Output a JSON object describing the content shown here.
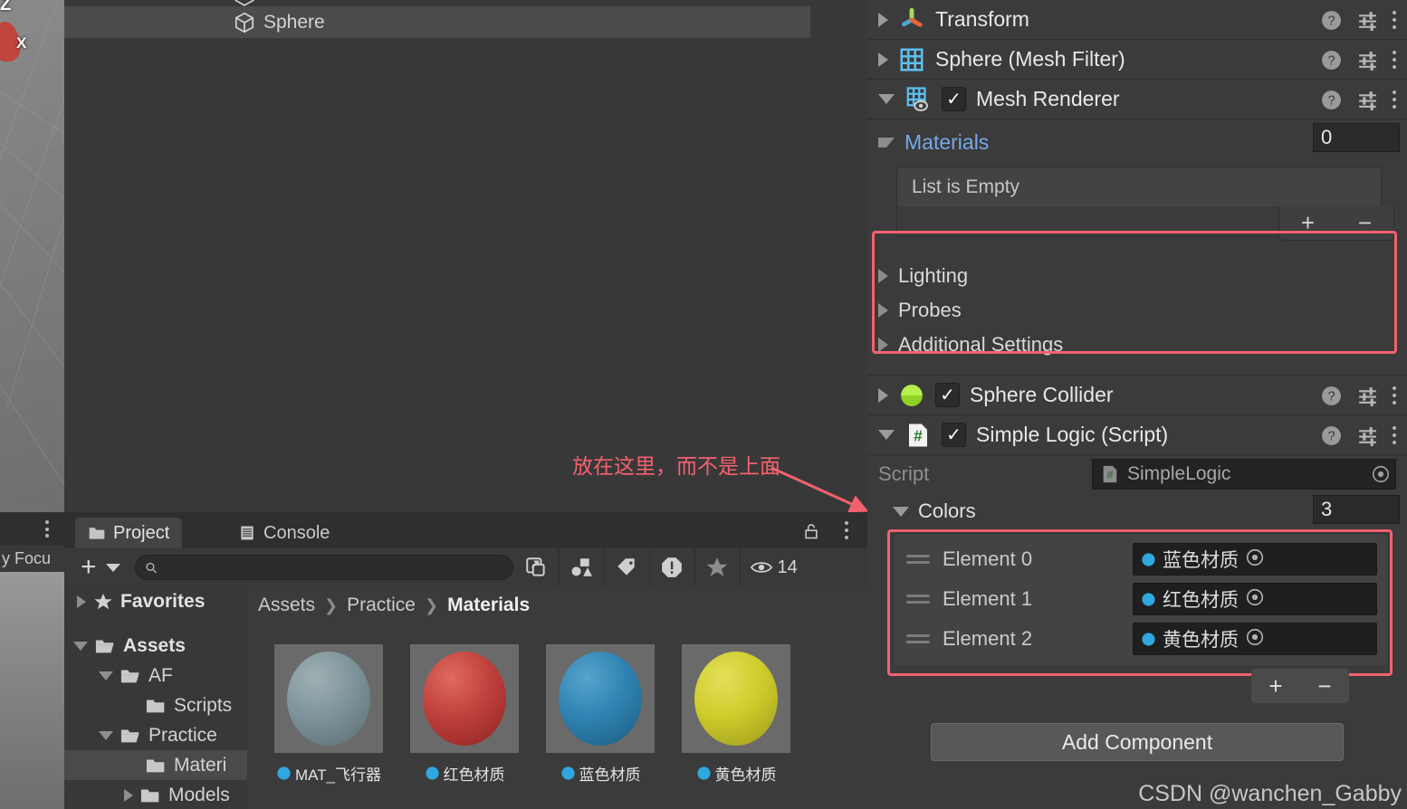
{
  "app": {
    "watermark": "CSDN @wanchen_Gabby"
  },
  "scene_view": {
    "gizmo_z": "Z",
    "gizmo_x": "X"
  },
  "left_low_panel": {
    "toolbar_text_clipped": "y Focu"
  },
  "hierarchy": {
    "rows": [
      {
        "label": "Sphere",
        "icon": "cube-icon",
        "selected": true,
        "indent": 186
      }
    ]
  },
  "annotation": {
    "text": "放在这里，而不是上面",
    "color": "#f4616e"
  },
  "project": {
    "tabs": [
      {
        "label": "Project",
        "icon": "folder-icon",
        "active": true
      },
      {
        "label": "Console",
        "icon": "console-icon",
        "active": false
      }
    ],
    "lock_icon": "unlock-icon",
    "menu_icon": "kebab-icon",
    "toolbar": {
      "create_label": "+",
      "search_value": "",
      "search_placeholder": "",
      "search_icon": "search-icon",
      "open_in_new_icon": "open-in-new-icon",
      "filter_type_icon": "filter-type-icon",
      "filter_label_icon": "label-tag-icon",
      "filter_warning_icon": "warning-icon",
      "filter_favorite_icon": "star-icon",
      "visible_icon": "eye-icon",
      "visible_count": "14"
    },
    "tree": [
      {
        "label": "Favorites",
        "depth": 0,
        "arrow": "closed",
        "icon": "star-icon",
        "bold": true,
        "selected": false
      },
      {
        "label": "Assets",
        "depth": 0,
        "arrow": "open",
        "icon": "folder-open-icon",
        "bold": true,
        "selected": false
      },
      {
        "label": "AF",
        "depth": 1,
        "arrow": "open",
        "icon": "folder-open-icon",
        "bold": false,
        "selected": false
      },
      {
        "label": "Scripts",
        "depth": 2,
        "arrow": "none",
        "icon": "folder-icon",
        "bold": false,
        "selected": false
      },
      {
        "label": "Practice",
        "depth": 1,
        "arrow": "open",
        "icon": "folder-open-icon",
        "bold": false,
        "selected": false
      },
      {
        "label": "Materi",
        "depth": 2,
        "arrow": "none",
        "icon": "folder-icon",
        "bold": false,
        "selected": true
      },
      {
        "label": "Models",
        "depth": 2,
        "arrow": "closed",
        "icon": "folder-icon",
        "bold": false,
        "selected": false
      }
    ],
    "breadcrumb": [
      "Assets",
      "Practice",
      "Materials"
    ],
    "assets": [
      {
        "name": "MAT_飞行器",
        "color": "#7e949a",
        "icon": "material-ball-icon"
      },
      {
        "name": "红色材质",
        "color": "#c0403c",
        "icon": "material-ball-icon"
      },
      {
        "name": "蓝色材质",
        "color": "#2f83b2",
        "icon": "material-ball-icon"
      },
      {
        "name": "黄色材质",
        "color": "#cfcc2c",
        "icon": "material-ball-icon"
      }
    ]
  },
  "inspector": {
    "components": [
      {
        "name": "Transform",
        "icon": "transform-gizmo-icon",
        "foldout": "closed",
        "has_checkbox": false
      },
      {
        "name": "Sphere (Mesh Filter)",
        "icon": "mesh-filter-icon",
        "foldout": "closed",
        "has_checkbox": false
      },
      {
        "name": "Mesh Renderer",
        "icon": "mesh-renderer-icon",
        "foldout": "open",
        "has_checkbox": true,
        "checked": true
      }
    ],
    "materials": {
      "title": "Materials",
      "title_color": "#77a7e8",
      "count": "0",
      "empty_text": "List is Empty",
      "add_label": "+",
      "remove_label": "−",
      "highlighted": true
    },
    "renderer_sections": [
      {
        "label": "Lighting"
      },
      {
        "label": "Probes"
      },
      {
        "label": "Additional Settings"
      }
    ],
    "collider": {
      "name": "Sphere Collider",
      "icon": "sphere-collider-icon",
      "checked": true
    },
    "script_component": {
      "name": "Simple Logic (Script)",
      "icon": "cs-script-icon",
      "checked": true,
      "script_label": "Script",
      "script_value": "SimpleLogic",
      "colors_label": "Colors",
      "colors_count": "3",
      "elements": [
        {
          "label": "Element 0",
          "value": "蓝色材质",
          "icon": "material-ball-icon"
        },
        {
          "label": "Element 1",
          "value": "红色材质",
          "icon": "material-ball-icon"
        },
        {
          "label": "Element 2",
          "value": "黄色材质",
          "icon": "material-ball-icon"
        }
      ],
      "add_label": "+",
      "remove_label": "−",
      "highlighted": true
    },
    "add_component_label": "Add Component",
    "help_icon": "help-icon",
    "preset_icon": "preset-icon",
    "menu_icon": "kebab-icon"
  }
}
